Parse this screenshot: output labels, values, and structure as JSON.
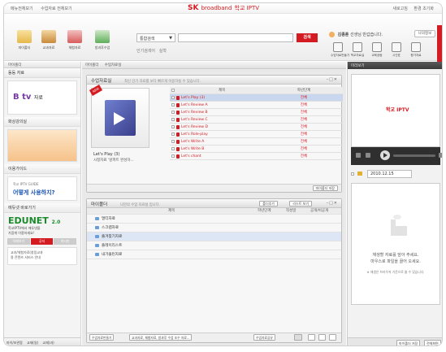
{
  "topbar": {
    "left_links": [
      "메뉴전체보기",
      "수업자료 전체보기"
    ],
    "brand_sk": "SK",
    "brand_broadband": "broadband",
    "brand_product": "학교 IPTV",
    "right_links": [
      "새로고침",
      "환경 초기화"
    ]
  },
  "toolbar": {
    "icons": [
      {
        "icon": "folder-icon",
        "label": "마이폴더"
      },
      {
        "icon": "book-icon",
        "label": "교과자료"
      },
      {
        "icon": "activity-icon",
        "label": "체험자료"
      },
      {
        "icon": "broadcast-icon",
        "label": "방과후수업"
      }
    ],
    "search_scope": "통합검색",
    "search_value": "",
    "search_button": "검색",
    "popular_label": "인기검색어",
    "popular_term": "실학",
    "user_name": "김종훈",
    "user_greeting": "선생님 반갑습니다.",
    "logout_label": "나의정보",
    "right_icons": [
      {
        "icon": "classroom-icon",
        "label": "수업자료만들기"
      },
      {
        "icon": "school-icon",
        "label": "학교자료실"
      },
      {
        "icon": "megaphone-icon",
        "label": "교육공람"
      },
      {
        "icon": "calendar-icon",
        "label": "시간표"
      },
      {
        "icon": "chart-icon",
        "label": "평가자료"
      }
    ]
  },
  "left": {
    "header": "마이폴더",
    "section_title": "동등 자료",
    "btv_label": "B tv",
    "btv_suffix": "자료",
    "section2": "화상강의실",
    "section3": "이용가이드",
    "guide_title": "학교 IPTV GUIDE",
    "guide_text": "어떻게 사용하지?",
    "section4": "에듀넷 바로가기",
    "edunet": "EDUNET",
    "edunet_ver": "2.0",
    "edunet_sub": "학교IPTV에서 에듀넷을",
    "edunet_sub2": "가깝게 이용하세요!",
    "tabs": [
      "어제보기",
      "공지",
      "게시판"
    ],
    "notice": "교과/체험자료(창링교과",
    "notice2": "용 콘텐츠 서비스 안내",
    "bottom_links": [
      "마이/보관함",
      "교재(일)",
      "교재(과)"
    ]
  },
  "center": {
    "tabs": [
      "마이폴더",
      "수업자료실"
    ],
    "lesson_panel": {
      "title": "수업자료실",
      "subtitle": "최신 인기 자료를 보다 빠르게 이용하실 수 있습니다.",
      "new_tag": "NEW",
      "thumb_title": "Let's Play (3)",
      "thumb_desc": "시청자료 '앞파트 완성하...",
      "col_title": "제목",
      "col_target": "학년단계",
      "rows": [
        {
          "title": "Let's Play (3)",
          "target": "전체"
        },
        {
          "title": "Let's Review A",
          "target": "전체"
        },
        {
          "title": "Let's Review B",
          "target": "전체"
        },
        {
          "title": "Let's Review C",
          "target": "전체"
        },
        {
          "title": "Let's Review D",
          "target": "전체"
        },
        {
          "title": "Let's Role-play",
          "target": "전체"
        },
        {
          "title": "Let's Write A",
          "target": "전체"
        },
        {
          "title": "Let's Write B",
          "target": "전체"
        },
        {
          "title": "Let's chant",
          "target": "전체"
        }
      ],
      "add_button": "마이폴더 저장"
    },
    "folder_panel": {
      "title": "마이폴더",
      "subtitle": "나만의 수업 자료실 입니다.",
      "btn_add": "폴더추가",
      "btn_view": "리스트 보기",
      "col_title": "제목",
      "col_grade": "학년단계",
      "col_author": "작성일",
      "col_public": "공개/비공개",
      "rows": [
        "멀티자료",
        "스크랩자료",
        "즐겨찾기자료",
        "플레이리스트",
        "내가올린자료"
      ],
      "footer_buttons": [
        "수업자료만들기",
        "교과자료, 체험자료, 방과후 수업 조수 자료..."
      ],
      "footer_right": [
        "수업자료공유"
      ]
    }
  },
  "right": {
    "header": "미리보기",
    "video_brand": "학교 IPTV",
    "date": "2010.12.15",
    "msg_line1": "재생할 자료를 담아 주세요.",
    "msg_line2": "마우스로 파일을 끌어 오세요.",
    "msg_note": "※ 재생은 브라우저 기준으로 볼 수 있습니다.",
    "bottom_buttons": [
      "마이폴더 저장",
      "전체화면"
    ]
  }
}
